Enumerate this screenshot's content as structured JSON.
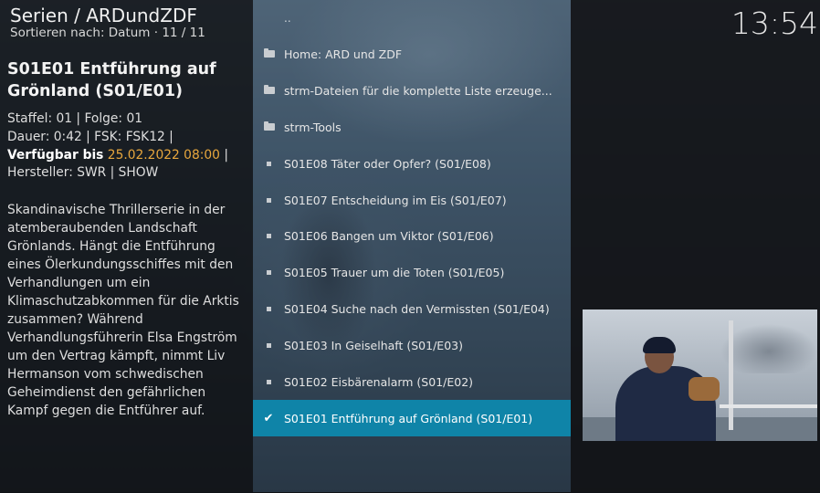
{
  "header": {
    "title": "Serien / ARDundZDF",
    "sort_line": "Sortieren nach: Datum  ·  11 / 11"
  },
  "clock": "13:54",
  "details": {
    "title": "S01E01  Entführung auf Grönland (S01/E01)",
    "line1": "Staffel: 01 | Folge: 01",
    "line2": "Dauer: 0:42 | FSK: FSK12 |",
    "line3_label": "Verfügbar bis",
    "line3_date": "25.02.2022 08:00",
    "line3_sep": " |",
    "line4": "Hersteller: SWR | SHOW",
    "plot": "Skandinavische Thrillerserie in der atemberaubenden Landschaft Grönlands. Hängt die Entführung eines Ölerkundungsschiffes mit den Verhandlungen um ein Klimaschutzabkommen für die Arktis zusammen? Während Verhandlungsführerin Elsa Engström um den Vertrag kämpft, nimmt Liv Hermanson vom schwedischen Geheimdienst den gefährlichen Kampf gegen die Entführer auf."
  },
  "list": {
    "items": [
      {
        "label": "..",
        "icon": "none"
      },
      {
        "label": "Home: ARD und ZDF",
        "icon": "folder-icon"
      },
      {
        "label": "strm-Dateien für die komplette Liste erzeuge...",
        "icon": "folder-icon"
      },
      {
        "label": "strm-Tools",
        "icon": "folder-icon"
      },
      {
        "label": "S01E08  Täter oder Opfer? (S01/E08)",
        "icon": "bullet-icon"
      },
      {
        "label": "S01E07  Entscheidung im Eis (S01/E07)",
        "icon": "bullet-icon"
      },
      {
        "label": "S01E06  Bangen um Viktor (S01/E06)",
        "icon": "bullet-icon"
      },
      {
        "label": "S01E05  Trauer um die Toten (S01/E05)",
        "icon": "bullet-icon"
      },
      {
        "label": "S01E04  Suche nach den Vermissten (S01/E04)",
        "icon": "bullet-icon"
      },
      {
        "label": "S01E03  In Geiselhaft (S01/E03)",
        "icon": "bullet-icon"
      },
      {
        "label": "S01E02  Eisbärenalarm (S01/E02)",
        "icon": "bullet-icon"
      },
      {
        "label": "S01E01  Entführung auf Grönland (S01/E01)",
        "icon": "check-icon"
      }
    ]
  },
  "colors": {
    "selection": "#0f84a8",
    "date_accent": "#e8a73d"
  }
}
